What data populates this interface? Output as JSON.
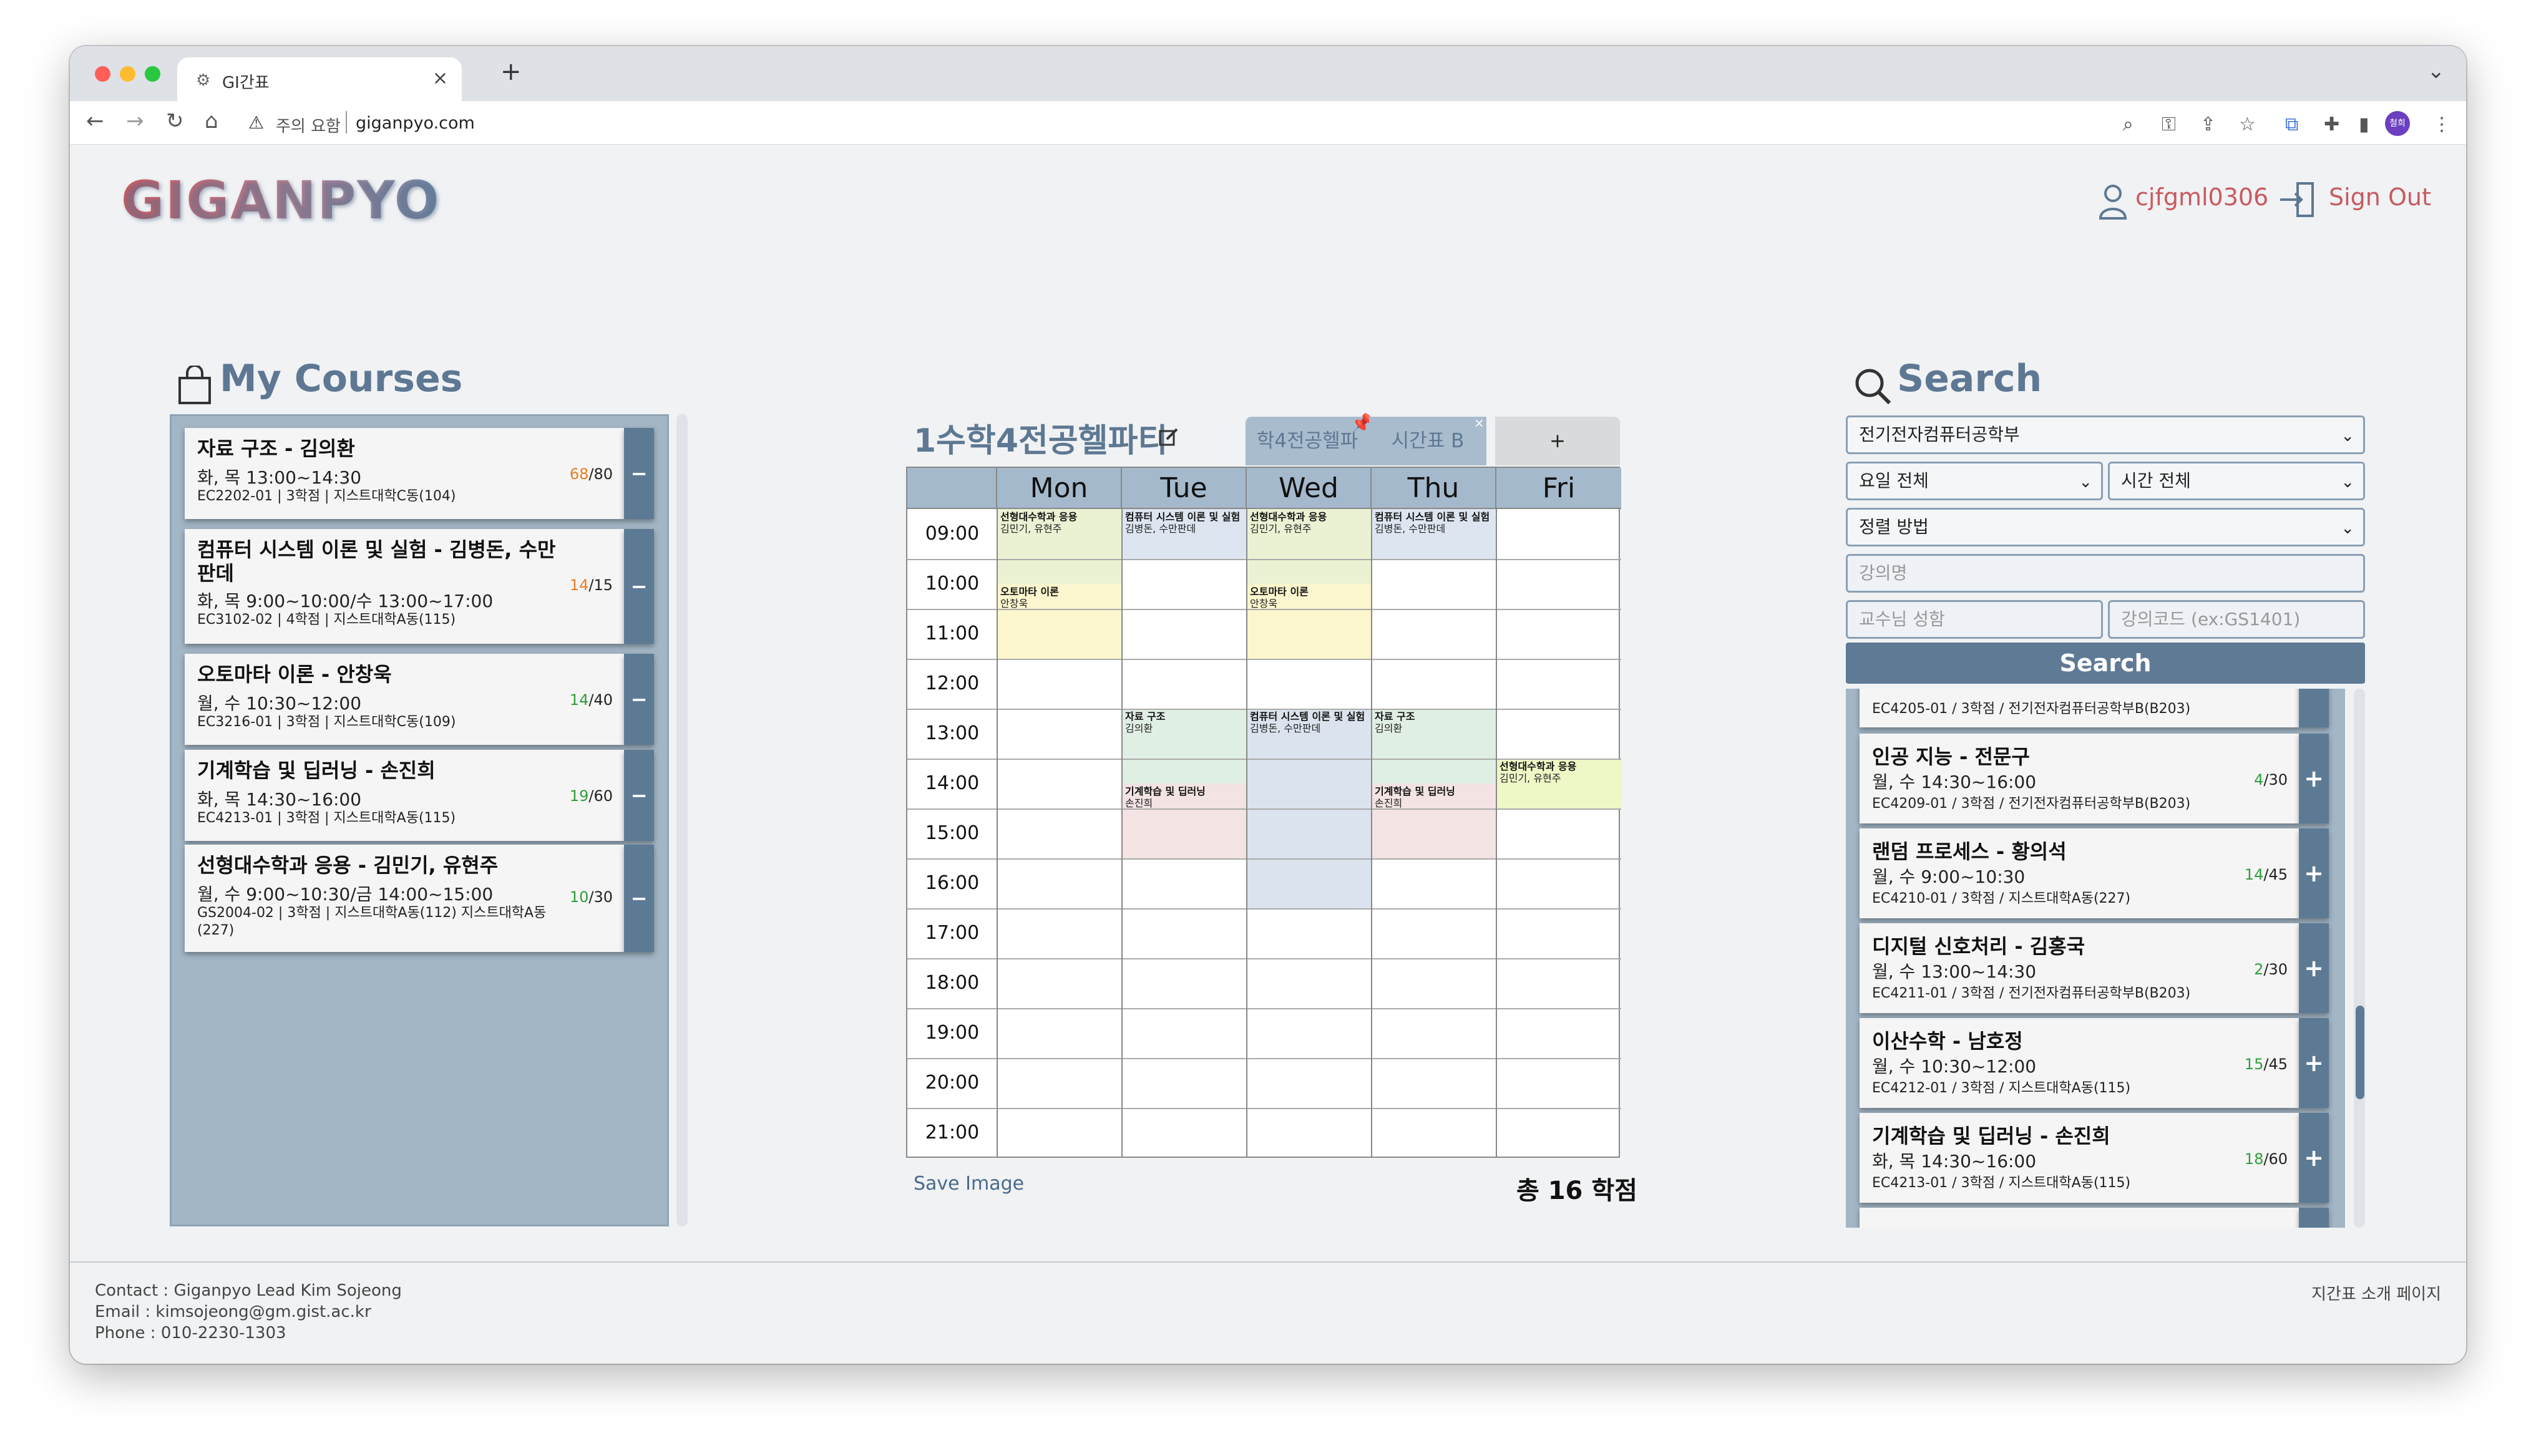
{
  "browser": {
    "tab_title": "GI간표",
    "new_tab": "+",
    "tab_close": "×",
    "security_label": "주의 요함",
    "url": "giganpyo.com",
    "profile_initials": "철희",
    "icons": [
      "back-icon",
      "forward-icon",
      "reload-icon",
      "home-icon",
      "warning-icon",
      "search-icon",
      "key-icon",
      "share-icon",
      "star-icon",
      "translate-icon",
      "extensions-icon",
      "download-icon",
      "sidebar-icon",
      "menu-icon"
    ]
  },
  "app": {
    "logo": "GIGANPYO",
    "username": "cjfgml0306",
    "sign_out": "Sign Out"
  },
  "my_courses": {
    "heading": "My Courses",
    "remove_label": "−",
    "items": [
      {
        "name": "자료 구조 - 김의환",
        "time": "화, 목 13:00~14:30",
        "meta": "EC2202-01 | 3학점 | 지스트대학C동(104)",
        "enrolled": "68",
        "capacity": "/80",
        "color": "#e67e22"
      },
      {
        "name": "컴퓨터 시스템 이론 및 실험 - 김병돈, 수만판데",
        "time": "화, 목 9:00~10:00/수 13:00~17:00",
        "meta": "EC3102-02 | 4학점 | 지스트대학A동(115)",
        "enrolled": "14",
        "capacity": "/15",
        "color": "#e67e22"
      },
      {
        "name": "오토마타 이론 - 안창욱",
        "time": "월, 수 10:30~12:00",
        "meta": "EC3216-01 | 3학점 | 지스트대학C동(109)",
        "enrolled": "14",
        "capacity": "/40",
        "color": "#2e9e3a"
      },
      {
        "name": "기계학습 및 딥러닝 - 손진희",
        "time": "화, 목 14:30~16:00",
        "meta": "EC4213-01 | 3학점 | 지스트대학A동(115)",
        "enrolled": "19",
        "capacity": "/60",
        "color": "#2e9e3a"
      },
      {
        "name": "선형대수학과 응용 - 김민기, 유현주",
        "time": "월, 수 9:00~10:30/금 14:00~15:00",
        "meta": "GS2004-02 | 3학점 | 지스트대학A동(112) 지스트대학A동 (227)",
        "enrolled": "10",
        "capacity": "/30",
        "color": "#2e9e3a"
      }
    ]
  },
  "schedule": {
    "title": "1수학4전공헬파티",
    "tabs": [
      {
        "label": "학4전공헬파"
      },
      {
        "label": "시간표 B"
      },
      {
        "label": "+"
      }
    ],
    "tab_close": "×",
    "days": [
      "Mon",
      "Tue",
      "Wed",
      "Thu",
      "Fri"
    ],
    "times": [
      "09:00",
      "10:00",
      "11:00",
      "12:00",
      "13:00",
      "14:00",
      "15:00",
      "16:00",
      "17:00",
      "18:00",
      "19:00",
      "20:00",
      "21:00"
    ],
    "blocks": [
      {
        "title": "선형대수학과 응용",
        "prof": "김민기, 유현주",
        "color": "#ebf2d3"
      },
      {
        "title": "컴퓨터 시스템 이론 및 실험",
        "prof": "김병돈, 수만판데",
        "color": "#dde5f0"
      },
      {
        "title": "선형대수학과 응용",
        "prof": "김민기, 유현주",
        "color": "#ebf2d3"
      },
      {
        "title": "컴퓨터 시스템 이론 및 실험",
        "prof": "김병돈, 수만판데",
        "color": "#dde5f0"
      },
      {
        "title": "오토마타 이론",
        "prof": "안창욱",
        "color": "#fbf6cd"
      },
      {
        "title": "오토마타 이론",
        "prof": "안창욱",
        "color": "#fbf6cd"
      },
      {
        "title": "자료 구조",
        "prof": "김의환",
        "color": "#e0efe4"
      },
      {
        "title": "컴퓨터 시스템 이론 및 실험",
        "prof": "김병돈, 수만판데",
        "color": "#dbe3ee"
      },
      {
        "title": "자료 구조",
        "prof": "김의환",
        "color": "#e0efe4"
      },
      {
        "title": "선형대수학과 응용",
        "prof": "김민기, 유현주",
        "color": "#eef7c6"
      },
      {
        "title": "기계학습 및 딥러닝",
        "prof": "손진희",
        "color": "#f3e3e3"
      },
      {
        "title": "기계학습 및 딥러닝",
        "prof": "손진희",
        "color": "#f3e3e3"
      }
    ],
    "save_image": "Save Image",
    "total": "총 16 학점"
  },
  "search": {
    "heading": "Search",
    "department": "전기전자컴퓨터공학부",
    "day": "요일 전체",
    "time": "시간 전체",
    "sort": "정렬 방법",
    "course_placeholder": "강의명",
    "prof_placeholder": "교수님 성함",
    "code_placeholder": "강의코드 (ex:GS1401)",
    "button": "Search",
    "add_label": "+",
    "partial_meta": "EC4205-01 / 3학점 / 전기전자컴퓨터공학부B(B203)",
    "results": [
      {
        "name": "인공 지능 - 전문구",
        "time": "월, 수 14:30~16:00",
        "meta": "EC4209-01 / 3학점 / 전기전자컴퓨터공학부B(B203)",
        "enrolled": "4",
        "capacity": "/30"
      },
      {
        "name": "랜덤 프로세스 - 황의석",
        "time": "월, 수 9:00~10:30",
        "meta": "EC4210-01 / 3학점 / 지스트대학A동(227)",
        "enrolled": "14",
        "capacity": "/45"
      },
      {
        "name": "디지털 신호처리 - 김홍국",
        "time": "월, 수 13:00~14:30",
        "meta": "EC4211-01 / 3학점 / 전기전자컴퓨터공학부B(B203)",
        "enrolled": "2",
        "capacity": "/30"
      },
      {
        "name": "이산수학 - 남호정",
        "time": "월, 수 10:30~12:00",
        "meta": "EC4212-01 / 3학점 / 지스트대학A동(115)",
        "enrolled": "15",
        "capacity": "/45"
      },
      {
        "name": "기계학습 및 딥러닝 - 손진희",
        "time": "화, 목 14:30~16:00",
        "meta": "EC4213-01 / 3학점 / 지스트대학A동(115)",
        "enrolled": "18",
        "capacity": "/60"
      }
    ]
  },
  "footer": {
    "contact": "Contact : Giganpyo Lead Kim Sojeong",
    "email": "Email : kimsojeong@gm.gist.ac.kr",
    "phone": "Phone : 010-2230-1303",
    "intro_link": "지간표 소개 페이지"
  }
}
